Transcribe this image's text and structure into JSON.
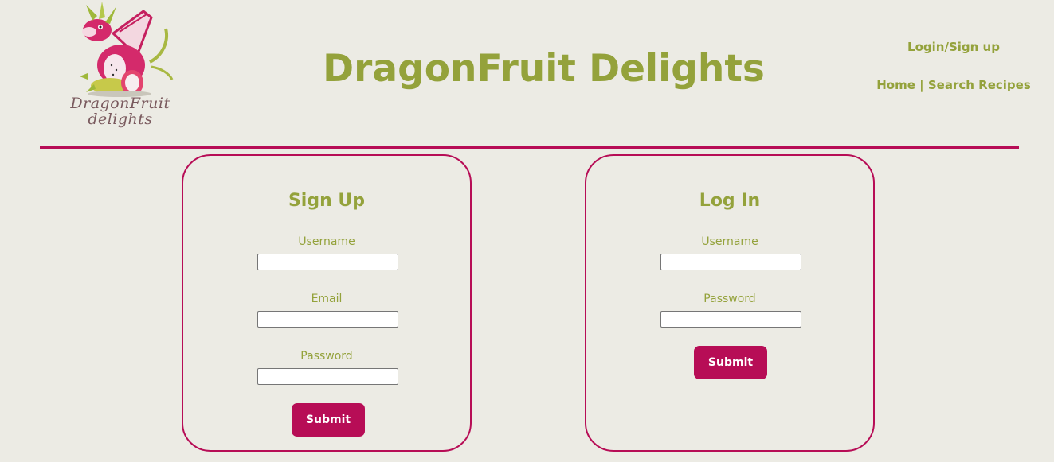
{
  "header": {
    "logo_text_line1": "DragonFruit",
    "logo_text_line2": "delights",
    "title": "DragonFruit Delights",
    "login_link": "Login/Sign up",
    "home_link": "Home",
    "separator": "|",
    "search_link": "Search Recipes"
  },
  "signup": {
    "title": "Sign Up",
    "username_label": "Username",
    "username_value": "",
    "email_label": "Email",
    "email_value": "",
    "password_label": "Password",
    "password_value": "",
    "submit_label": "Submit"
  },
  "login": {
    "title": "Log In",
    "username_label": "Username",
    "username_value": "",
    "password_label": "Password",
    "password_value": "",
    "submit_label": "Submit"
  },
  "colors": {
    "background": "#ecebe4",
    "accent_green": "#94a23b",
    "accent_magenta": "#b70d56"
  }
}
